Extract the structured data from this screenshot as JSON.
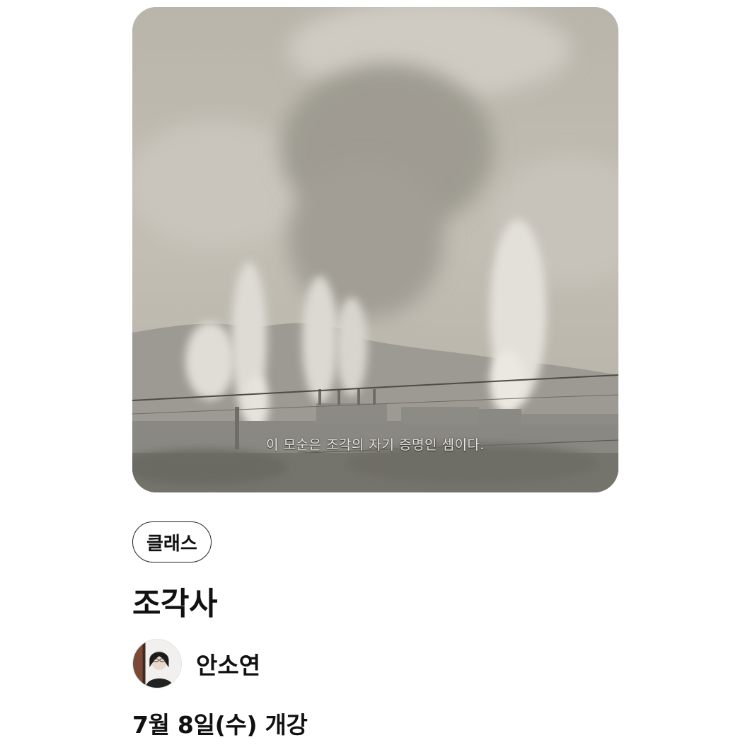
{
  "card": {
    "image": {
      "description_icon": "video-still-image",
      "subtitle": "이 모순은 조각의 자기 증명인 셈이다."
    },
    "category_chip": "클래스",
    "title": "조각사",
    "author": {
      "name": "안소연",
      "avatar_icon": "author-avatar"
    },
    "schedule": "7월 8일(수) 개강"
  }
}
